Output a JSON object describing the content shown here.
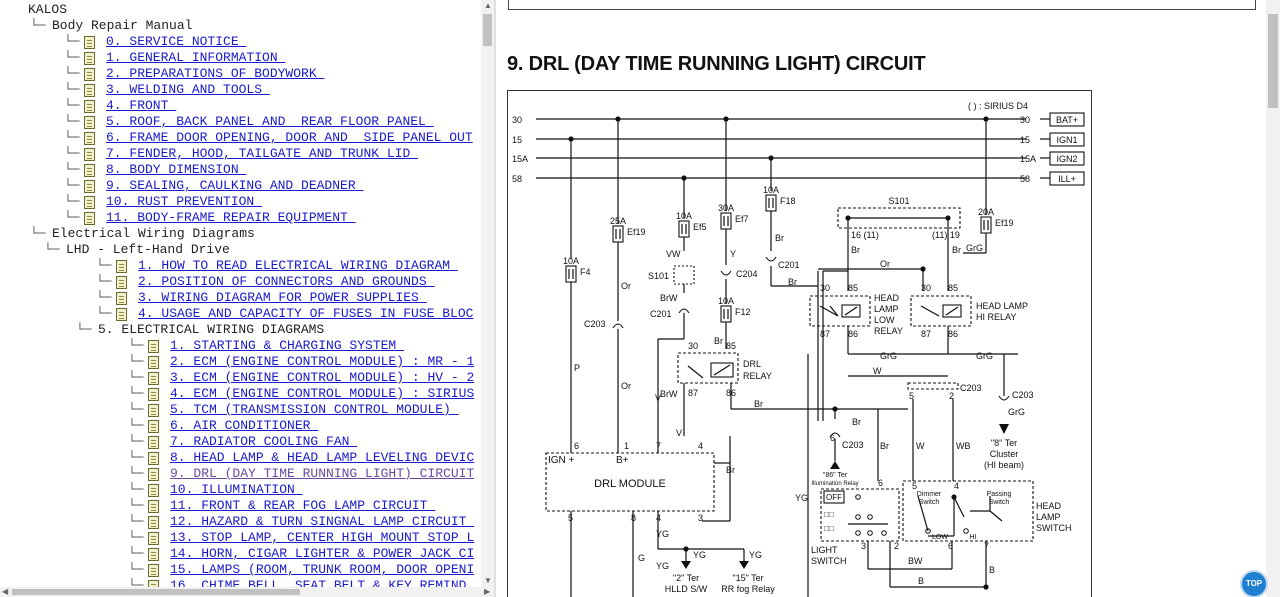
{
  "tree": [
    {
      "indent": 0,
      "conn": "",
      "icon": false,
      "label": "KALOS",
      "link": false
    },
    {
      "indent": 1,
      "conn": "└─",
      "icon": false,
      "label": "Body Repair Manual",
      "link": false
    },
    {
      "indent": 2,
      "conn": "└─",
      "icon": true,
      "label": "0. SERVICE NOTICE ",
      "link": true
    },
    {
      "indent": 2,
      "conn": "└─",
      "icon": true,
      "label": "1. GENERAL INFORMATION ",
      "link": true
    },
    {
      "indent": 2,
      "conn": "└─",
      "icon": true,
      "label": "2. PREPARATIONS OF BODYWORK ",
      "link": true
    },
    {
      "indent": 2,
      "conn": "└─",
      "icon": true,
      "label": "3. WELDING AND TOOLS ",
      "link": true
    },
    {
      "indent": 2,
      "conn": "└─",
      "icon": true,
      "label": "4. FRONT ",
      "link": true
    },
    {
      "indent": 2,
      "conn": "└─",
      "icon": true,
      "label": "5. ROOF, BACK PANEL AND  REAR FLOOR PANEL ",
      "link": true
    },
    {
      "indent": 2,
      "conn": "└─",
      "icon": true,
      "label": "6. FRAME DOOR OPENING, DOOR AND  SIDE PANEL OUT",
      "link": true
    },
    {
      "indent": 2,
      "conn": "└─",
      "icon": true,
      "label": "7. FENDER, HOOD, TAILGATE AND TRUNK LID ",
      "link": true
    },
    {
      "indent": 2,
      "conn": "└─",
      "icon": true,
      "label": "8. BODY DIMENSION ",
      "link": true
    },
    {
      "indent": 2,
      "conn": "└─",
      "icon": true,
      "label": "9. SEALING, CAULKING AND DEADNER ",
      "link": true
    },
    {
      "indent": 2,
      "conn": "└─",
      "icon": true,
      "label": "10. RUST PREVENTION ",
      "link": true
    },
    {
      "indent": 2,
      "conn": "└─",
      "icon": true,
      "label": "11. BODY-FRAME REPAIR EQUIPMENT ",
      "link": true
    },
    {
      "indent": 1,
      "conn": "└─",
      "icon": false,
      "label": "Electrical Wiring Diagrams",
      "link": false
    },
    {
      "indent": 2,
      "conn": "└─",
      "icon": false,
      "label": "LHD - Left-Hand Drive",
      "link": false
    },
    {
      "indent": 3,
      "conn": "└─",
      "icon": true,
      "label": "1. HOW TO READ ELECTRICAL WIRING DIAGRAM ",
      "link": true
    },
    {
      "indent": 3,
      "conn": "└─",
      "icon": true,
      "label": "2. POSITION OF CONNECTORS AND GROUNDS ",
      "link": true
    },
    {
      "indent": 3,
      "conn": "└─",
      "icon": true,
      "label": "3. WIRING DIAGRAM FOR POWER SUPPLIES ",
      "link": true
    },
    {
      "indent": 3,
      "conn": "└─",
      "icon": true,
      "label": "4. USAGE AND CAPACITY OF FUSES IN FUSE BLOC",
      "link": true
    },
    {
      "indent": 3,
      "conn": "└─",
      "icon": false,
      "label": "5. ELECTRICAL WIRING DIAGRAMS",
      "link": false
    },
    {
      "indent": 4,
      "conn": "└─",
      "icon": true,
      "label": "1. STARTING & CHARGING SYSTEM ",
      "link": true
    },
    {
      "indent": 4,
      "conn": "└─",
      "icon": true,
      "label": "2. ECM (ENGINE CONTROL MODULE) : MR - 1",
      "link": true
    },
    {
      "indent": 4,
      "conn": "└─",
      "icon": true,
      "label": "3. ECM (ENGINE CONTROL MODULE) : HV - 2",
      "link": true
    },
    {
      "indent": 4,
      "conn": "└─",
      "icon": true,
      "label": "4. ECM (ENGINE CONTROL MODULE) : SIRIUS",
      "link": true
    },
    {
      "indent": 4,
      "conn": "└─",
      "icon": true,
      "label": "5. TCM (TRANSMISSION CONTROL MODULE) ",
      "link": true
    },
    {
      "indent": 4,
      "conn": "└─",
      "icon": true,
      "label": "6. AIR CONDITIONER ",
      "link": true
    },
    {
      "indent": 4,
      "conn": "└─",
      "icon": true,
      "label": "7. RADIATOR COOLING FAN ",
      "link": true
    },
    {
      "indent": 4,
      "conn": "└─",
      "icon": true,
      "label": "8. HEAD LAMP & HEAD LAMP LEVELING DEVIC",
      "link": true
    },
    {
      "indent": 4,
      "conn": "└─",
      "icon": true,
      "label": "9. DRL (DAY TIME RUNNING LIGHT) CIRCUIT",
      "link": true,
      "visited": true
    },
    {
      "indent": 4,
      "conn": "└─",
      "icon": true,
      "label": "10. ILLUMINATION ",
      "link": true
    },
    {
      "indent": 4,
      "conn": "└─",
      "icon": true,
      "label": "11. FRONT & REAR FOG LAMP CIRCUIT ",
      "link": true
    },
    {
      "indent": 4,
      "conn": "└─",
      "icon": true,
      "label": "12. HAZARD & TURN SINGNAL LAMP CIRCUIT ",
      "link": true
    },
    {
      "indent": 4,
      "conn": "└─",
      "icon": true,
      "label": "13. STOP LAMP, CENTER HIGH MOUNT STOP L",
      "link": true
    },
    {
      "indent": 4,
      "conn": "└─",
      "icon": true,
      "label": "14. HORN, CIGAR LIGHTER & POWER JACK CI",
      "link": true
    },
    {
      "indent": 4,
      "conn": "└─",
      "icon": true,
      "label": "15. LAMPS (ROOM, TRUNK ROOM, DOOR OPENI",
      "link": true
    },
    {
      "indent": 4,
      "conn": "└─",
      "icon": true,
      "label": "16. CHIME BELL, SEAT BELT & KEY REMIND",
      "link": true
    }
  ],
  "page": {
    "title": "9. DRL (DAY TIME RUNNING LIGHT) CIRCUIT",
    "top_button": "TOP"
  },
  "diagram": {
    "variant_note": "( ) : SIRIUS D4",
    "rails": [
      {
        "left": "30",
        "right": "30",
        "tag": "BAT+"
      },
      {
        "left": "15",
        "right": "15",
        "tag": "IGN1"
      },
      {
        "left": "15A",
        "right": "15A",
        "tag": "IGN2"
      },
      {
        "left": "58",
        "right": "58",
        "tag": "ILL+"
      }
    ],
    "fuses": {
      "f4": [
        "10A",
        "F4"
      ],
      "ef19a": [
        "25A",
        "Ef19"
      ],
      "ef5": [
        "10A",
        "Ef5"
      ],
      "ef7": [
        "30A",
        "Ef7"
      ],
      "f18": [
        "10A",
        "F18"
      ],
      "ef19b": [
        "20A",
        "Ef19"
      ],
      "f12": [
        "10A",
        "F12"
      ]
    },
    "labels": {
      "s101": "S101",
      "s101b": "S101",
      "c201": "C201",
      "c201b": "C201",
      "c204": "C204",
      "c203": "C203",
      "c203b": "C203",
      "c203c": "C203",
      "c203d": "C203",
      "drl_relay": "DRL RELAY",
      "drl_module": "DRL MODULE",
      "ign": "IGN +",
      "bplus": "B+",
      "hl_low_relay": [
        "HEAD",
        "LAMP",
        "LOW",
        "RELAY"
      ],
      "hl_hi_relay": [
        "HEAD LAMP",
        "HI RELAY"
      ],
      "cluster": [
        "\"8\" Ter",
        "Cluster",
        "(HI beam)"
      ],
      "illum": [
        "\"86\" Ter",
        "Illumination Relay"
      ],
      "light_switch": [
        "LIGHT",
        "SWITCH"
      ],
      "head_lamp_switch": [
        "HEAD",
        "LAMP",
        "SWITCH"
      ],
      "dimmer": [
        "Dimmer",
        "Switch"
      ],
      "passing": [
        "Passing",
        "Switch"
      ],
      "off": "OFF",
      "low": "LOW",
      "hi": "HI",
      "hlld": [
        "\"2\" Ter",
        "HLLD S/W"
      ],
      "rrfog": [
        "\"15\" Ter",
        "RR fog Relay"
      ]
    },
    "wire_colors": [
      "Or",
      "Br",
      "Y",
      "VW",
      "BrW",
      "BrW",
      "V",
      "P",
      "Or",
      "Br",
      "Br",
      "GrG",
      "GrG",
      "W",
      "WB",
      "W",
      "BW",
      "B",
      "YG",
      "YG",
      "YG",
      "G",
      "GrG",
      "B",
      "Br"
    ]
  }
}
